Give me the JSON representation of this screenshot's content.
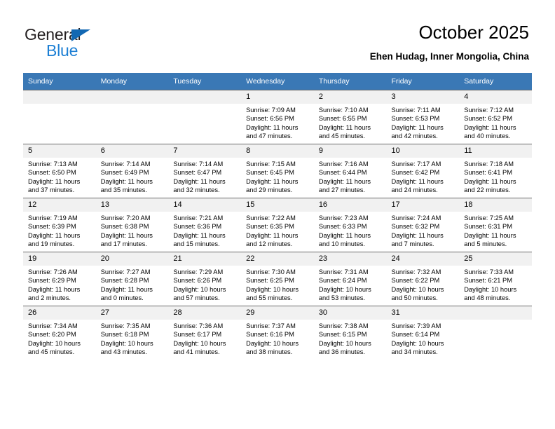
{
  "brand": {
    "name_part1": "General",
    "name_part2": "Blue",
    "accent_color": "#1c7fd4",
    "logo_triangle_color": "#1268b3"
  },
  "header": {
    "title": "October 2025",
    "location": "Ehen Hudag, Inner Mongolia, China",
    "header_row_color": "#3a78b5"
  },
  "weekday_headers": [
    "Sunday",
    "Monday",
    "Tuesday",
    "Wednesday",
    "Thursday",
    "Friday",
    "Saturday"
  ],
  "weeks": [
    [
      {
        "day": "",
        "empty": true
      },
      {
        "day": "",
        "empty": true
      },
      {
        "day": "",
        "empty": true
      },
      {
        "day": "1",
        "sunrise": "Sunrise: 7:09 AM",
        "sunset": "Sunset: 6:56 PM",
        "daylight_line1": "Daylight: 11 hours",
        "daylight_line2": "and 47 minutes."
      },
      {
        "day": "2",
        "sunrise": "Sunrise: 7:10 AM",
        "sunset": "Sunset: 6:55 PM",
        "daylight_line1": "Daylight: 11 hours",
        "daylight_line2": "and 45 minutes."
      },
      {
        "day": "3",
        "sunrise": "Sunrise: 7:11 AM",
        "sunset": "Sunset: 6:53 PM",
        "daylight_line1": "Daylight: 11 hours",
        "daylight_line2": "and 42 minutes."
      },
      {
        "day": "4",
        "sunrise": "Sunrise: 7:12 AM",
        "sunset": "Sunset: 6:52 PM",
        "daylight_line1": "Daylight: 11 hours",
        "daylight_line2": "and 40 minutes."
      }
    ],
    [
      {
        "day": "5",
        "sunrise": "Sunrise: 7:13 AM",
        "sunset": "Sunset: 6:50 PM",
        "daylight_line1": "Daylight: 11 hours",
        "daylight_line2": "and 37 minutes."
      },
      {
        "day": "6",
        "sunrise": "Sunrise: 7:14 AM",
        "sunset": "Sunset: 6:49 PM",
        "daylight_line1": "Daylight: 11 hours",
        "daylight_line2": "and 35 minutes."
      },
      {
        "day": "7",
        "sunrise": "Sunrise: 7:14 AM",
        "sunset": "Sunset: 6:47 PM",
        "daylight_line1": "Daylight: 11 hours",
        "daylight_line2": "and 32 minutes."
      },
      {
        "day": "8",
        "sunrise": "Sunrise: 7:15 AM",
        "sunset": "Sunset: 6:45 PM",
        "daylight_line1": "Daylight: 11 hours",
        "daylight_line2": "and 29 minutes."
      },
      {
        "day": "9",
        "sunrise": "Sunrise: 7:16 AM",
        "sunset": "Sunset: 6:44 PM",
        "daylight_line1": "Daylight: 11 hours",
        "daylight_line2": "and 27 minutes."
      },
      {
        "day": "10",
        "sunrise": "Sunrise: 7:17 AM",
        "sunset": "Sunset: 6:42 PM",
        "daylight_line1": "Daylight: 11 hours",
        "daylight_line2": "and 24 minutes."
      },
      {
        "day": "11",
        "sunrise": "Sunrise: 7:18 AM",
        "sunset": "Sunset: 6:41 PM",
        "daylight_line1": "Daylight: 11 hours",
        "daylight_line2": "and 22 minutes."
      }
    ],
    [
      {
        "day": "12",
        "sunrise": "Sunrise: 7:19 AM",
        "sunset": "Sunset: 6:39 PM",
        "daylight_line1": "Daylight: 11 hours",
        "daylight_line2": "and 19 minutes."
      },
      {
        "day": "13",
        "sunrise": "Sunrise: 7:20 AM",
        "sunset": "Sunset: 6:38 PM",
        "daylight_line1": "Daylight: 11 hours",
        "daylight_line2": "and 17 minutes."
      },
      {
        "day": "14",
        "sunrise": "Sunrise: 7:21 AM",
        "sunset": "Sunset: 6:36 PM",
        "daylight_line1": "Daylight: 11 hours",
        "daylight_line2": "and 15 minutes."
      },
      {
        "day": "15",
        "sunrise": "Sunrise: 7:22 AM",
        "sunset": "Sunset: 6:35 PM",
        "daylight_line1": "Daylight: 11 hours",
        "daylight_line2": "and 12 minutes."
      },
      {
        "day": "16",
        "sunrise": "Sunrise: 7:23 AM",
        "sunset": "Sunset: 6:33 PM",
        "daylight_line1": "Daylight: 11 hours",
        "daylight_line2": "and 10 minutes."
      },
      {
        "day": "17",
        "sunrise": "Sunrise: 7:24 AM",
        "sunset": "Sunset: 6:32 PM",
        "daylight_line1": "Daylight: 11 hours",
        "daylight_line2": "and 7 minutes."
      },
      {
        "day": "18",
        "sunrise": "Sunrise: 7:25 AM",
        "sunset": "Sunset: 6:31 PM",
        "daylight_line1": "Daylight: 11 hours",
        "daylight_line2": "and 5 minutes."
      }
    ],
    [
      {
        "day": "19",
        "sunrise": "Sunrise: 7:26 AM",
        "sunset": "Sunset: 6:29 PM",
        "daylight_line1": "Daylight: 11 hours",
        "daylight_line2": "and 2 minutes."
      },
      {
        "day": "20",
        "sunrise": "Sunrise: 7:27 AM",
        "sunset": "Sunset: 6:28 PM",
        "daylight_line1": "Daylight: 11 hours",
        "daylight_line2": "and 0 minutes."
      },
      {
        "day": "21",
        "sunrise": "Sunrise: 7:29 AM",
        "sunset": "Sunset: 6:26 PM",
        "daylight_line1": "Daylight: 10 hours",
        "daylight_line2": "and 57 minutes."
      },
      {
        "day": "22",
        "sunrise": "Sunrise: 7:30 AM",
        "sunset": "Sunset: 6:25 PM",
        "daylight_line1": "Daylight: 10 hours",
        "daylight_line2": "and 55 minutes."
      },
      {
        "day": "23",
        "sunrise": "Sunrise: 7:31 AM",
        "sunset": "Sunset: 6:24 PM",
        "daylight_line1": "Daylight: 10 hours",
        "daylight_line2": "and 53 minutes."
      },
      {
        "day": "24",
        "sunrise": "Sunrise: 7:32 AM",
        "sunset": "Sunset: 6:22 PM",
        "daylight_line1": "Daylight: 10 hours",
        "daylight_line2": "and 50 minutes."
      },
      {
        "day": "25",
        "sunrise": "Sunrise: 7:33 AM",
        "sunset": "Sunset: 6:21 PM",
        "daylight_line1": "Daylight: 10 hours",
        "daylight_line2": "and 48 minutes."
      }
    ],
    [
      {
        "day": "26",
        "sunrise": "Sunrise: 7:34 AM",
        "sunset": "Sunset: 6:20 PM",
        "daylight_line1": "Daylight: 10 hours",
        "daylight_line2": "and 45 minutes."
      },
      {
        "day": "27",
        "sunrise": "Sunrise: 7:35 AM",
        "sunset": "Sunset: 6:18 PM",
        "daylight_line1": "Daylight: 10 hours",
        "daylight_line2": "and 43 minutes."
      },
      {
        "day": "28",
        "sunrise": "Sunrise: 7:36 AM",
        "sunset": "Sunset: 6:17 PM",
        "daylight_line1": "Daylight: 10 hours",
        "daylight_line2": "and 41 minutes."
      },
      {
        "day": "29",
        "sunrise": "Sunrise: 7:37 AM",
        "sunset": "Sunset: 6:16 PM",
        "daylight_line1": "Daylight: 10 hours",
        "daylight_line2": "and 38 minutes."
      },
      {
        "day": "30",
        "sunrise": "Sunrise: 7:38 AM",
        "sunset": "Sunset: 6:15 PM",
        "daylight_line1": "Daylight: 10 hours",
        "daylight_line2": "and 36 minutes."
      },
      {
        "day": "31",
        "sunrise": "Sunrise: 7:39 AM",
        "sunset": "Sunset: 6:14 PM",
        "daylight_line1": "Daylight: 10 hours",
        "daylight_line2": "and 34 minutes."
      },
      {
        "day": "",
        "empty": true
      }
    ]
  ]
}
